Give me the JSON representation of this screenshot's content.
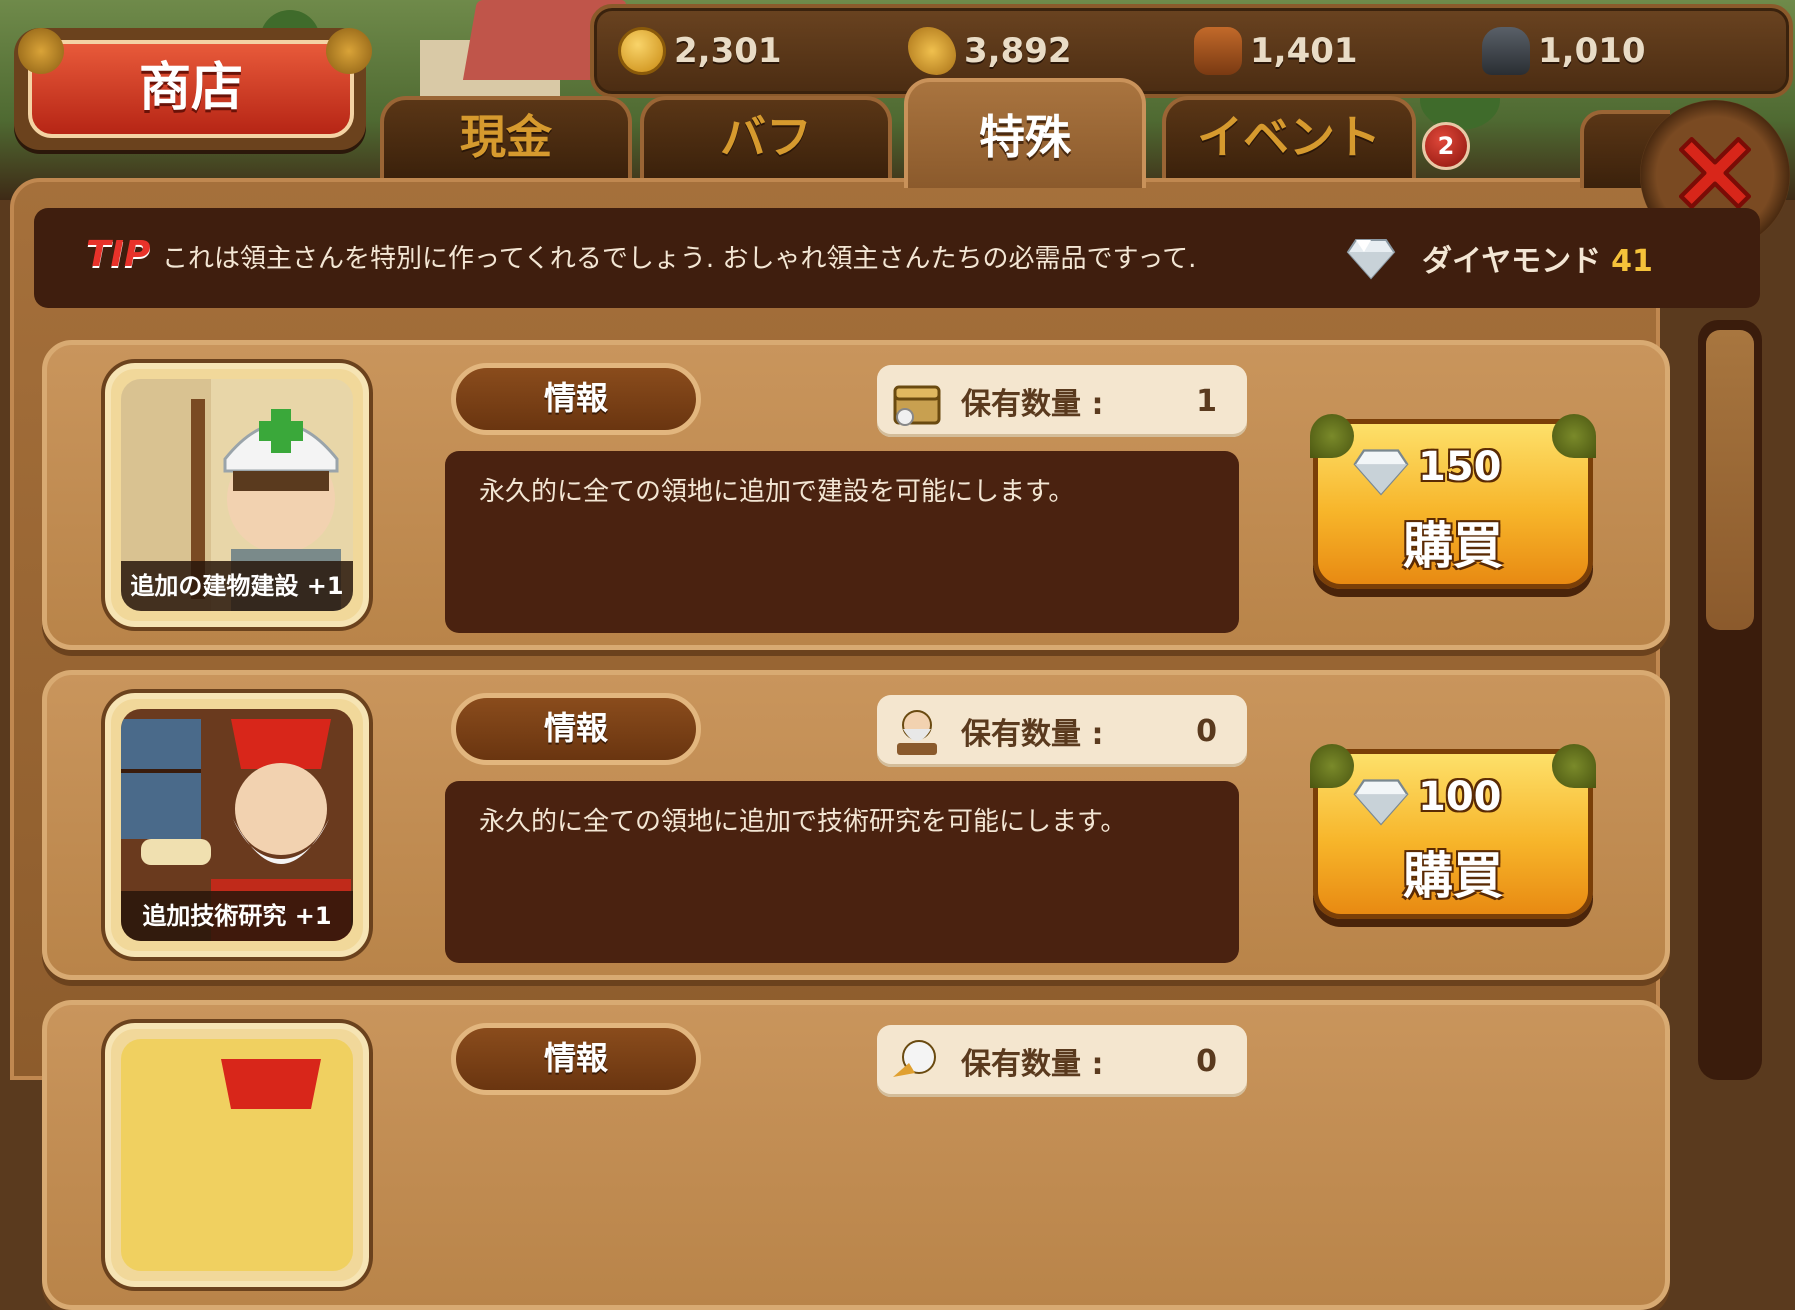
{
  "resources": [
    {
      "icon": "gold-coin-icon",
      "value": "2,301"
    },
    {
      "icon": "grain-icon",
      "value": "3,892"
    },
    {
      "icon": "wood-icon",
      "value": "1,401"
    },
    {
      "icon": "stone-icon",
      "value": "1,010"
    }
  ],
  "shop_title": "商店",
  "tabs": [
    {
      "label": "現金",
      "active": false
    },
    {
      "label": "バフ",
      "active": false
    },
    {
      "label": "特殊",
      "active": true
    },
    {
      "label": "イベント",
      "active": false
    }
  ],
  "event_badge": "2",
  "tip": {
    "label": "TIP",
    "text": "これは領主さんを特別に作ってくれるでしょう. おしゃれ領主さんたちの必需品ですって.",
    "diamond_label": "ダイヤモンド",
    "diamond_value": "41"
  },
  "items": [
    {
      "caption": "追加の建物建設 +1",
      "info_label": "情報",
      "owned_label": "保有数量 :",
      "owned_value": "1",
      "description": "永久的に全ての領地に追加で建設を可能にします。",
      "price": "150",
      "buy_label": "購買"
    },
    {
      "caption": "追加技術研究 +1",
      "info_label": "情報",
      "owned_label": "保有数量 :",
      "owned_value": "0",
      "description": "永久的に全ての領地に追加で技術研究を可能にします。",
      "price": "100",
      "buy_label": "購買"
    },
    {
      "caption": "",
      "info_label": "情報",
      "owned_label": "保有数量 :",
      "owned_value": "0",
      "description": "",
      "price": "",
      "buy_label": ""
    }
  ],
  "colors": {
    "accent_gold": "#f5c23a",
    "tip_red": "#e8322a",
    "tab_inactive_text": "#d69a2e",
    "panel_brown": "#a5703b"
  }
}
